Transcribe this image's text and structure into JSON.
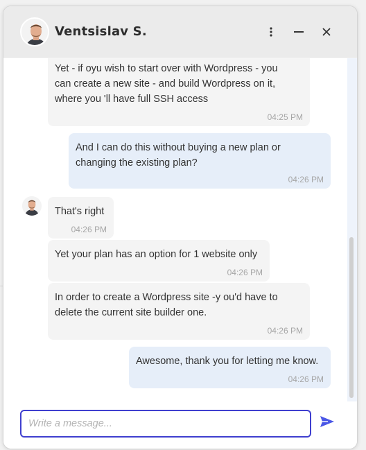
{
  "colors": {
    "accent": "#3f3fcf",
    "send_icon": "#4a57e6",
    "incoming_bubble": "#f4f4f4",
    "outgoing_bubble": "#e6eef9",
    "header_bg": "#ebebeb"
  },
  "header": {
    "agent_name": "Ventsislav S.",
    "icons": [
      "more-vertical-icon",
      "minimize-icon",
      "close-icon"
    ]
  },
  "messages": [
    {
      "direction": "in",
      "text": "Yet - if oyu wish to start over with Wordpress - you\ncan create a new site - and build Wordpress on it,\nwhere you 'll have full SSH access",
      "time": "04:25 PM"
    },
    {
      "direction": "out",
      "text": "And I can do this without buying a new plan or\nchanging the existing plan?",
      "time": "04:26 PM"
    },
    {
      "direction": "in",
      "text": "That's right",
      "time": "04:26 PM",
      "avatar": true
    },
    {
      "direction": "in",
      "text": "Yet your plan has an option for 1 website only",
      "time": "04:26 PM"
    },
    {
      "direction": "in",
      "text": "In order to create a Wordpress site -y ou'd have to\ndelete the current site builder one.",
      "time": "04:26 PM"
    },
    {
      "direction": "out",
      "text": "Awesome, thank you for letting me know.",
      "time": "04:26 PM"
    }
  ],
  "composer": {
    "placeholder": "Write a message...",
    "value": ""
  }
}
